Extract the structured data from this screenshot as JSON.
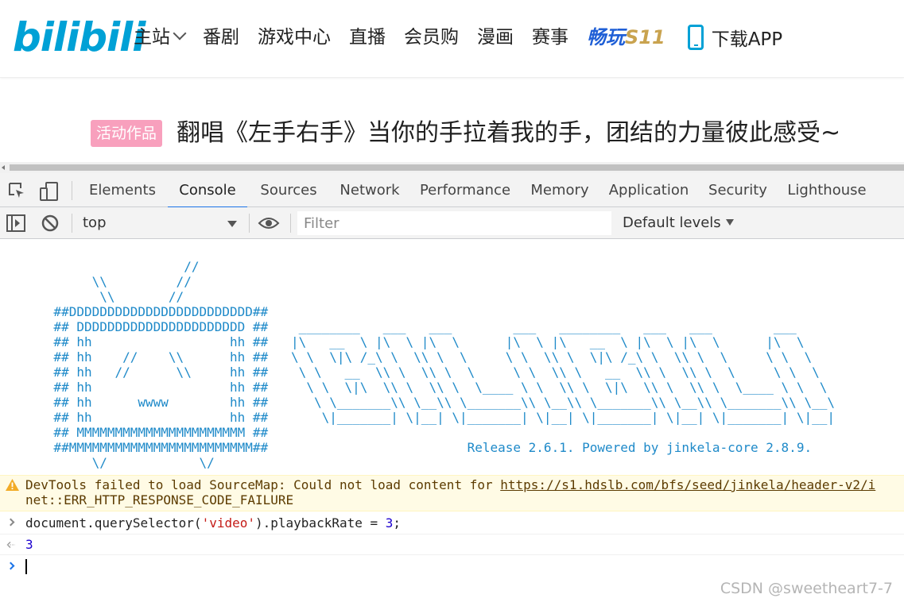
{
  "header": {
    "logo": "bilibili",
    "nav": [
      {
        "label": "主站"
      },
      {
        "label": "番剧"
      },
      {
        "label": "游戏中心"
      },
      {
        "label": "直播"
      },
      {
        "label": "会员购"
      },
      {
        "label": "漫画"
      },
      {
        "label": "赛事"
      }
    ],
    "s11_prefix": "畅玩",
    "s11_suffix": "S11",
    "download": "下载APP"
  },
  "video": {
    "badge": "活动作品",
    "title": "翻唱《左手右手》当你的手拉着我的手，团结的力量彼此感受~"
  },
  "devtools": {
    "tabs": [
      "Elements",
      "Console",
      "Sources",
      "Network",
      "Performance",
      "Memory",
      "Application",
      "Security",
      "Lighthouse"
    ],
    "active_tab": "Console",
    "context": "top",
    "filter_placeholder": "Filter",
    "levels": "Default levels",
    "accent": "#1a73e8"
  },
  "console": {
    "ascii_art": "                        //\n            \\\\         //\n             \\\\       //\n       ##DDDDDDDDDDDDDDDDDDDDDDDD##\n       ## DDDDDDDDDDDDDDDDDDDDDD ##    ________   ___   ___        ___   ________   ___   ___        ___\n       ## hh                  hh ##   |\\   __  \\ |\\  \\ |\\  \\      |\\  \\ |\\   __  \\ |\\  \\ |\\  \\      |\\  \\\n       ## hh    //    \\\\      hh ##   \\ \\  \\|\\ /_\\ \\  \\\\ \\  \\     \\ \\  \\\\ \\  \\|\\ /_\\ \\  \\\\ \\  \\     \\ \\  \\\n       ## hh   //      \\\\     hh ##    \\ \\   __  \\\\ \\  \\\\ \\  \\     \\ \\  \\\\ \\   __  \\\\ \\  \\\\ \\  \\     \\ \\  \\\n       ## hh                  hh ##     \\ \\  \\|\\  \\\\ \\  \\\\ \\  \\____ \\ \\  \\\\ \\  \\|\\  \\\\ \\  \\\\ \\  \\____ \\ \\  \\\n       ## hh      wwww        hh ##      \\ \\_______\\\\ \\__\\\\ \\_______\\\\ \\__\\\\ \\_______\\\\ \\__\\\\ \\_______\\\\ \\__\\\n       ## hh                  hh ##       \\|_______| \\|__| \\|_______| \\|__| \\|_______| \\|__| \\|_______| \\|__|\n       ## MMMMMMMMMMMMMMMMMMMMMM ##\n       ##MMMMMMMMMMMMMMMMMMMMMMMM##                          Release 2.6.1. Powered by jinkela-core 2.8.9.\n            \\/            \\/",
    "warning_text": "DevTools failed to load SourceMap: Could not load content for ",
    "warning_url": "https://s1.hdslb.com/bfs/seed/jinkela/header-v2/i",
    "warning_error": "net::ERR_HTTP_RESPONSE_CODE_FAILURE",
    "command_prefix": "document.querySelector(",
    "command_string": "'video'",
    "command_mid": ").playbackRate = ",
    "command_number": "3",
    "command_suffix": ";",
    "result": "3"
  },
  "watermark": "CSDN @sweetheart7-7"
}
